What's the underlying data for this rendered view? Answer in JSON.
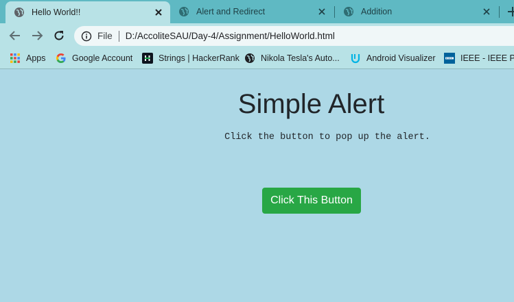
{
  "browser": {
    "tabs": [
      {
        "title": "Hello World!!",
        "active": true
      },
      {
        "title": "Alert and Redirect",
        "active": false
      },
      {
        "title": "Addition",
        "active": false
      }
    ],
    "omnibox": {
      "security_label": "File",
      "url": "D:/AccoliteSAU/Day-4/Assignment/HelloWorld.html"
    },
    "bookmarks": [
      {
        "label": "Apps",
        "icon": "apps-grid-icon"
      },
      {
        "label": "Google Account",
        "icon": "google-icon"
      },
      {
        "label": "Strings | HackerRank",
        "icon": "hackerrank-icon"
      },
      {
        "label": "Nikola Tesla's Auto...",
        "icon": "globe-icon"
      },
      {
        "label": "Android Visualizer",
        "icon": "udacity-icon"
      },
      {
        "label": "IEEE - IEEE Priva",
        "icon": "ieee-icon"
      }
    ]
  },
  "page": {
    "heading": "Simple Alert",
    "description": "Click the button to pop up the alert.",
    "button_label": "Click This Button",
    "button_color": "#28a745",
    "background_color": "#add8e6"
  }
}
